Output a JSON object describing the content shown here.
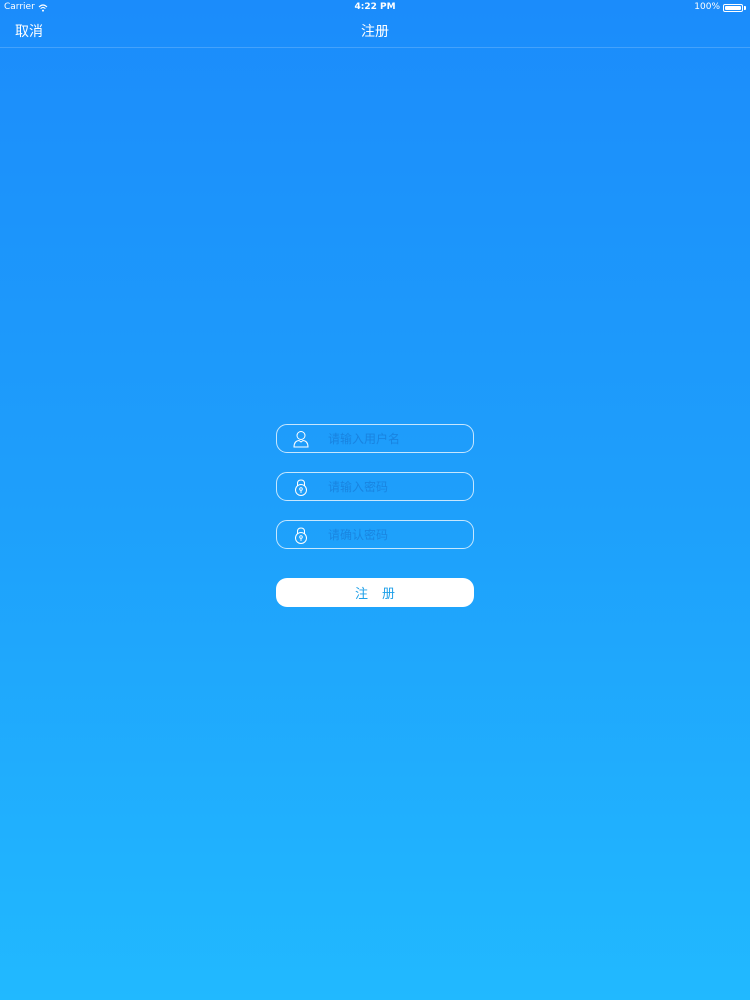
{
  "status_bar": {
    "carrier": "Carrier",
    "time": "4:22 PM",
    "battery_percent": "100%",
    "battery_level": 1.0
  },
  "nav": {
    "cancel_label": "取消",
    "title": "注册"
  },
  "form": {
    "username": {
      "placeholder": "请输入用户名",
      "value": "",
      "icon": "user-icon"
    },
    "password": {
      "placeholder": "请输入密码",
      "value": "",
      "icon": "lock-icon"
    },
    "confirm_password": {
      "placeholder": "请确认密码",
      "value": "",
      "icon": "lock-icon"
    },
    "submit_label": "注册"
  },
  "colors": {
    "background_top": "#1b8cfb",
    "background_bottom": "#21b9ff",
    "button_text": "#1d9fe8"
  }
}
